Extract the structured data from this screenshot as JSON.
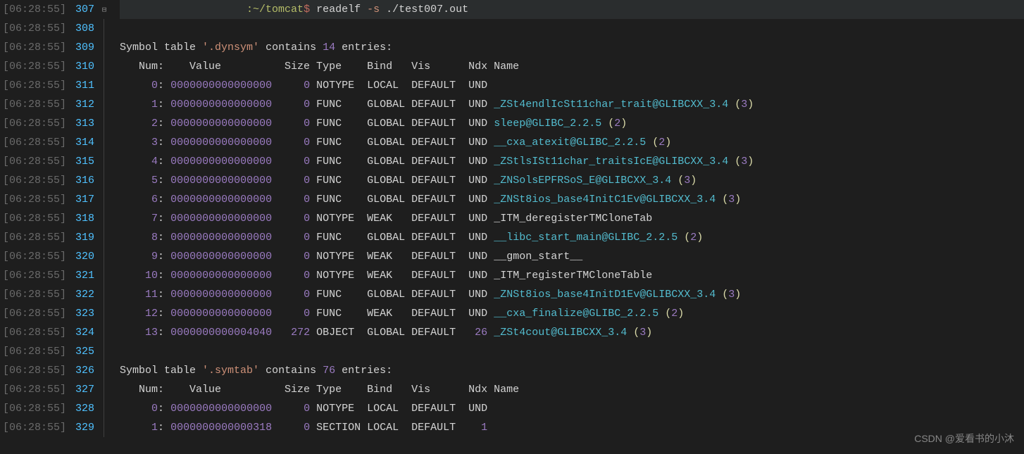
{
  "timestamp": "[06:28:55]",
  "startLine": 307,
  "prompt": {
    "path": ":~/tomcat",
    "sep": "$",
    "cmd": "readelf",
    "flag": "-s",
    "arg": "./test007.out"
  },
  "dynsym": {
    "prefix": "Symbol table ",
    "name": "'.dynsym'",
    "mid": " contains ",
    "count": "14",
    "suffix": " entries:"
  },
  "header": {
    "num": "Num:",
    "value": "Value",
    "size": "Size",
    "type": "Type",
    "bind": "Bind",
    "vis": "Vis",
    "ndx": "Ndx",
    "name": "Name"
  },
  "rows": [
    {
      "n": "0",
      "v": "0000000000000000",
      "s": "0",
      "t": "NOTYPE",
      "b": "LOCAL",
      "vi": "DEFAULT",
      "x": "UND",
      "nm": "",
      "p": ""
    },
    {
      "n": "1",
      "v": "0000000000000000",
      "s": "0",
      "t": "FUNC",
      "b": "GLOBAL",
      "vi": "DEFAULT",
      "x": "UND",
      "nm": "_ZSt4endlIcSt11char_trait@GLIBCXX_3.4",
      "p": "3"
    },
    {
      "n": "2",
      "v": "0000000000000000",
      "s": "0",
      "t": "FUNC",
      "b": "GLOBAL",
      "vi": "DEFAULT",
      "x": "UND",
      "nm": "sleep@GLIBC_2.2.5",
      "p": "2"
    },
    {
      "n": "3",
      "v": "0000000000000000",
      "s": "0",
      "t": "FUNC",
      "b": "GLOBAL",
      "vi": "DEFAULT",
      "x": "UND",
      "nm": "__cxa_atexit@GLIBC_2.2.5",
      "p": "2"
    },
    {
      "n": "4",
      "v": "0000000000000000",
      "s": "0",
      "t": "FUNC",
      "b": "GLOBAL",
      "vi": "DEFAULT",
      "x": "UND",
      "nm": "_ZStlsISt11char_traitsIcE@GLIBCXX_3.4",
      "p": "3"
    },
    {
      "n": "5",
      "v": "0000000000000000",
      "s": "0",
      "t": "FUNC",
      "b": "GLOBAL",
      "vi": "DEFAULT",
      "x": "UND",
      "nm": "_ZNSolsEPFRSoS_E@GLIBCXX_3.4",
      "p": "3"
    },
    {
      "n": "6",
      "v": "0000000000000000",
      "s": "0",
      "t": "FUNC",
      "b": "GLOBAL",
      "vi": "DEFAULT",
      "x": "UND",
      "nm": "_ZNSt8ios_base4InitC1Ev@GLIBCXX_3.4",
      "p": "3"
    },
    {
      "n": "7",
      "v": "0000000000000000",
      "s": "0",
      "t": "NOTYPE",
      "b": "WEAK",
      "vi": "DEFAULT",
      "x": "UND",
      "nm": "_ITM_deregisterTMCloneTab",
      "p": ""
    },
    {
      "n": "8",
      "v": "0000000000000000",
      "s": "0",
      "t": "FUNC",
      "b": "GLOBAL",
      "vi": "DEFAULT",
      "x": "UND",
      "nm": "__libc_start_main@GLIBC_2.2.5",
      "p": "2"
    },
    {
      "n": "9",
      "v": "0000000000000000",
      "s": "0",
      "t": "NOTYPE",
      "b": "WEAK",
      "vi": "DEFAULT",
      "x": "UND",
      "nm": "__gmon_start__",
      "p": ""
    },
    {
      "n": "10",
      "v": "0000000000000000",
      "s": "0",
      "t": "NOTYPE",
      "b": "WEAK",
      "vi": "DEFAULT",
      "x": "UND",
      "nm": "_ITM_registerTMCloneTable",
      "p": ""
    },
    {
      "n": "11",
      "v": "0000000000000000",
      "s": "0",
      "t": "FUNC",
      "b": "GLOBAL",
      "vi": "DEFAULT",
      "x": "UND",
      "nm": "_ZNSt8ios_base4InitD1Ev@GLIBCXX_3.4",
      "p": "3"
    },
    {
      "n": "12",
      "v": "0000000000000000",
      "s": "0",
      "t": "FUNC",
      "b": "WEAK",
      "vi": "DEFAULT",
      "x": "UND",
      "nm": "__cxa_finalize@GLIBC_2.2.5",
      "p": "2"
    },
    {
      "n": "13",
      "v": "0000000000004040",
      "s": "272",
      "t": "OBJECT",
      "b": "GLOBAL",
      "vi": "DEFAULT",
      "x": "26",
      "nm": "_ZSt4cout@GLIBCXX_3.4",
      "p": "3"
    }
  ],
  "symtab": {
    "prefix": "Symbol table ",
    "name": "'.symtab'",
    "mid": " contains ",
    "count": "76",
    "suffix": " entries:"
  },
  "rows2": [
    {
      "n": "0",
      "v": "0000000000000000",
      "s": "0",
      "t": "NOTYPE",
      "b": "LOCAL",
      "vi": "DEFAULT",
      "x": "UND",
      "nm": "",
      "p": ""
    },
    {
      "n": "1",
      "v": "0000000000000318",
      "s": "0",
      "t": "SECTION",
      "b": "LOCAL",
      "vi": "DEFAULT",
      "x": "1",
      "nm": "",
      "p": ""
    }
  ],
  "watermark": "CSDN @爱看书的小沐"
}
